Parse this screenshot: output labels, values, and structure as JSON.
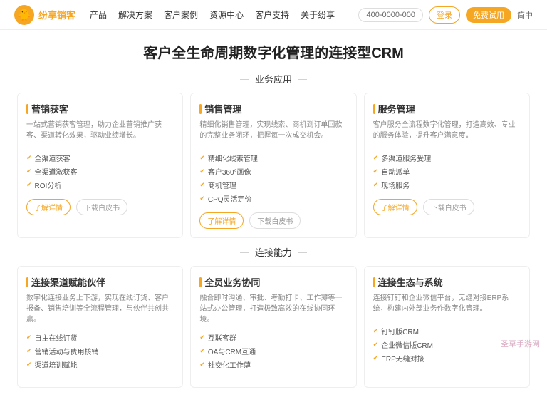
{
  "header": {
    "logo_emoji": "🐥",
    "logo_name": "纷享销客",
    "nav_items": [
      "产品",
      "解决方案",
      "客户案例",
      "资源中心",
      "客户支持",
      "关于纷享"
    ],
    "phone_label": "400-0000-000",
    "login_label": "登录",
    "trial_label": "免费试用",
    "lang_label": "简中"
  },
  "main": {
    "title": "客户全生命周期数字化管理的连接型CRM",
    "section1_label": "业务应用",
    "section2_label": "连接能力",
    "cards_section1": [
      {
        "title": "营销获客",
        "desc": "一站式营销获客管理，助力企业营销推广获客、渠道转化效果，驱动业绩增长。",
        "features": [
          "全渠道获客",
          "全渠道激获客",
          "ROI分析"
        ],
        "btn_detail": "了解详情",
        "btn_whitepaper": "下载白皮书"
      },
      {
        "title": "销售管理",
        "desc": "精细化销售管理，实现线索、商机到订单回款的完整业务闭环，把握每一次成交机会。",
        "features": [
          "精细化线索管理",
          "客户360°画像",
          "商机管理",
          "CPQ灵活定价"
        ],
        "btn_detail": "了解详情",
        "btn_whitepaper": "下载白皮书"
      },
      {
        "title": "服务管理",
        "desc": "客户服务全流程数字化管理，打造高效、专业的服务体验，提升客户满意度。",
        "features": [
          "多渠道服务受理",
          "自动派单",
          "现场服务"
        ],
        "btn_detail": "了解详情",
        "btn_whitepaper": "下载白皮书"
      }
    ],
    "cards_section2": [
      {
        "title": "连接渠道赋能伙伴",
        "desc": "数字化连接业务上下游，实现在线订货、客户报备、销售培训等全流程管理，与伙伴共创共赢。",
        "features": [
          "自主在线订货",
          "营销活动与费用核销",
          "渠道培训赋能"
        ],
        "btn_detail": "",
        "btn_whitepaper": ""
      },
      {
        "title": "全员业务协同",
        "desc": "融合即时沟通、审批、考勤打卡、工作薄等一站式办公管理，打造极致高效的在线协同环境。",
        "features": [
          "互联客群",
          "OA与CRM互通",
          "社交化工作薄"
        ],
        "btn_detail": "",
        "btn_whitepaper": ""
      },
      {
        "title": "连接生态与系统",
        "desc": "连接钉钉和企业微信平台，无缝对接ERP系统，构建内外部业务作数字化管理。",
        "features": [
          "钉钉版CRM",
          "企业微信版CRM",
          "ERP无缝对接"
        ],
        "btn_detail": "",
        "btn_whitepaper": ""
      }
    ]
  },
  "watermark": "圣草手游网"
}
